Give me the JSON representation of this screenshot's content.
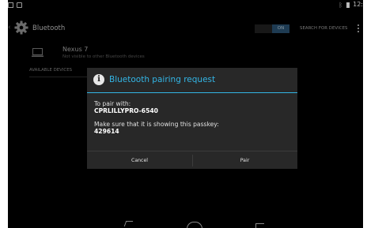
{
  "app": {
    "title": "Bluetooth",
    "toggle_state": "ON",
    "search_label": "SEARCH FOR DEVICES",
    "status_time": "12:",
    "accent_color": "#33b5e5"
  },
  "paired_device": {
    "name": "Nexus 7",
    "status": "Not visible to other Bluetooth devices"
  },
  "section_header": "AVAILABLE DEVICES",
  "dialog": {
    "title": "Bluetooth pairing request",
    "pair_with_label": "To pair with:",
    "device_name": "CPRLILLYPRO-6540",
    "passkey_prompt": "Make sure that it is showing this passkey:",
    "passkey": "429614",
    "cancel_label": "Cancel",
    "pair_label": "Pair"
  },
  "icons": {
    "settings": "gear-icon",
    "device": "laptop-icon",
    "info": "info-icon",
    "bluetooth": "bluetooth-icon",
    "battery": "battery-icon"
  }
}
